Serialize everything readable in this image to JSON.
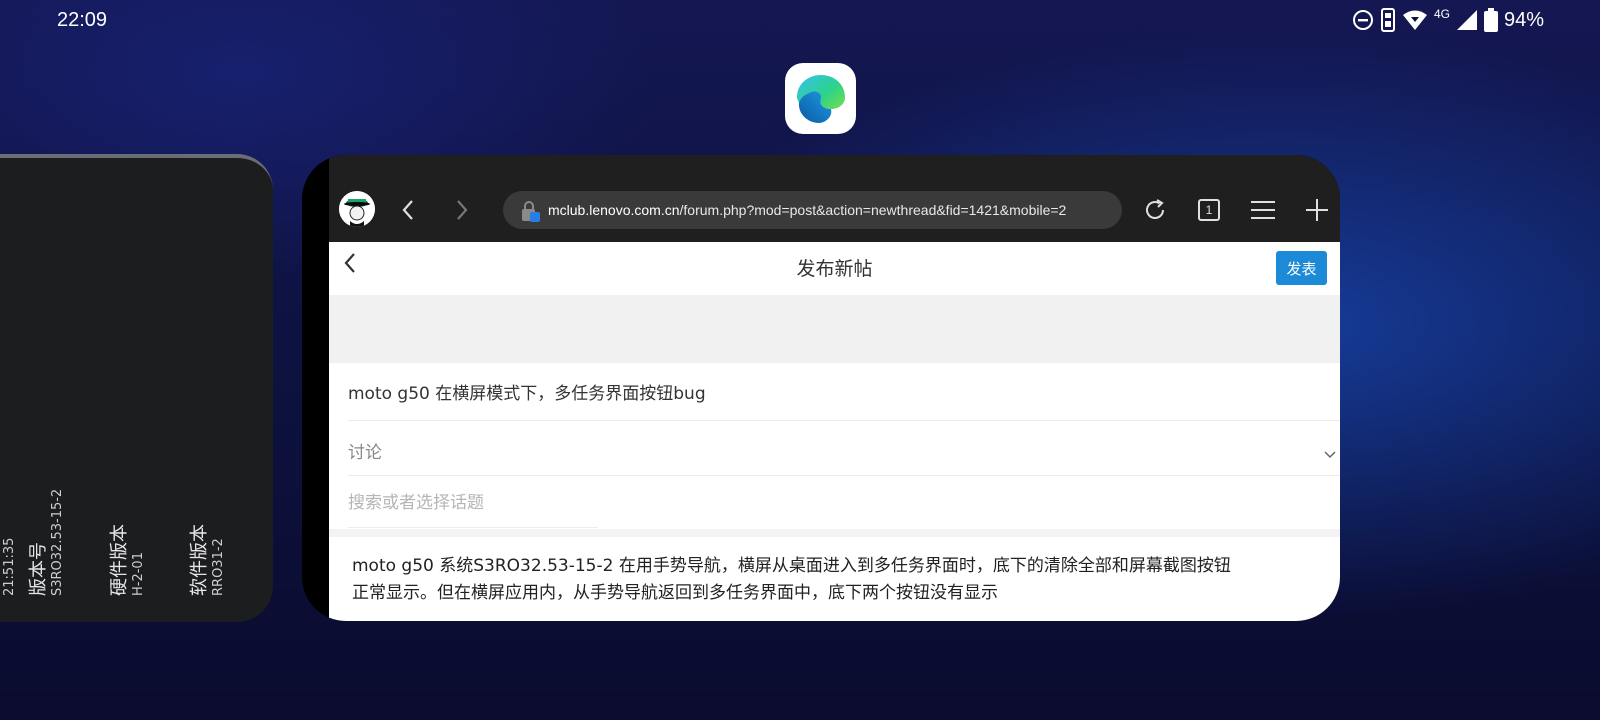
{
  "status_bar": {
    "time": "22:09",
    "network": "4G",
    "battery": "94%",
    "icons": [
      "dnd-icon",
      "vibrate-icon",
      "wifi-icon",
      "signal-icon",
      "battery-icon"
    ]
  },
  "recent_app": {
    "icon": "edge-browser-icon",
    "name": "Microsoft Edge"
  },
  "left_card": {
    "time_partial": "21:51:35",
    "fields": [
      {
        "label": "版本号",
        "value": "S3RO32.53-15-2"
      },
      {
        "label": "硬件版本",
        "value": "H-2-01"
      },
      {
        "label": "软件版本",
        "value": "RRO31-2"
      }
    ]
  },
  "browser": {
    "url_domain": "mclub.lenovo.com.cn",
    "url_path": "/forum.php?mod=post&action=newthread&fid=1421&mobile=2",
    "tab_count": "1"
  },
  "page": {
    "title": "发布新帖",
    "publish_label": "发表",
    "subject": "moto g50 在横屏模式下，多任务界面按钮bug",
    "category": "讨论",
    "topic_placeholder": "搜索或者选择话题",
    "body_line1": "moto g50 系统S3RO32.53-15-2 在用手势导航，横屏从桌面进入到多任务界面时，底下的清除全部和屏幕截图按钮",
    "body_line2": "正常显示。但在横屏应用内，从手势导航返回到多任务界面中，底下两个按钮没有显示"
  },
  "colors": {
    "accent": "#1c8ad6",
    "browser_bar": "#1f1f1f",
    "url_field": "#3a3a3a"
  }
}
